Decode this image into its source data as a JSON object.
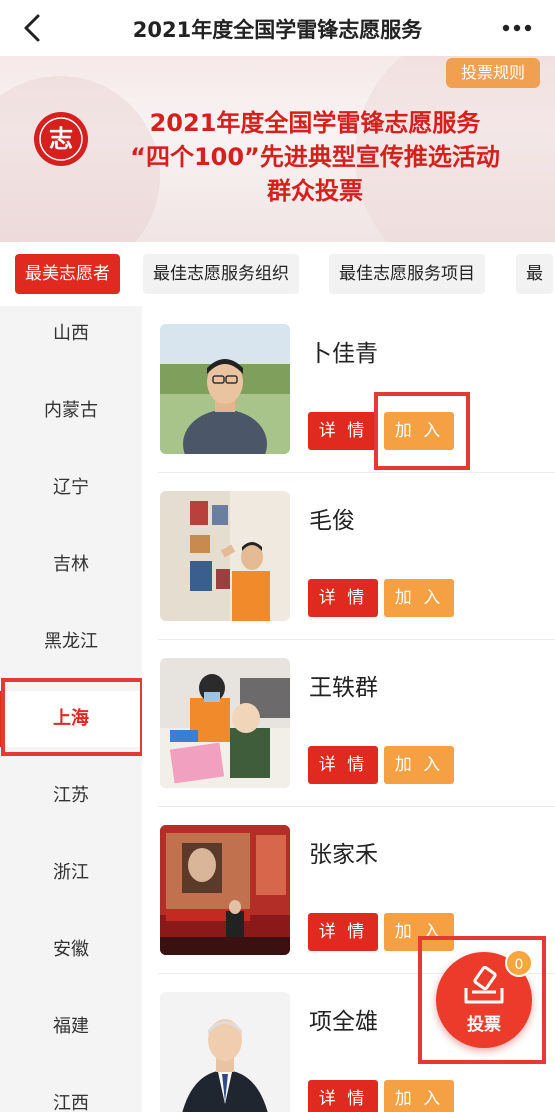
{
  "header": {
    "title": "2021年度全国学雷锋志愿服务",
    "back_icon": "chevron-left-icon",
    "more_icon": "more-icon"
  },
  "banner": {
    "rules_label": "投票规则",
    "line1": "2021年度全国学雷锋志愿服务",
    "line2": "“四个100”先进典型宣传推选活动",
    "line3": "群众投票",
    "logo_char": "志"
  },
  "categories": [
    "最美志愿者",
    "最佳志愿服务组织",
    "最佳志愿服务项目",
    "最"
  ],
  "provinces": [
    "山西",
    "内蒙古",
    "辽宁",
    "吉林",
    "黑龙江",
    "上海",
    "江苏",
    "浙江",
    "安徽",
    "福建",
    "江西"
  ],
  "cards": [
    {
      "name": "卜佳青",
      "detail_label": "详 情",
      "join_label": "加 入"
    },
    {
      "name": "毛俊",
      "detail_label": "详 情",
      "join_label": "加 入"
    },
    {
      "name": "王轶群",
      "detail_label": "详 情",
      "join_label": "加 入"
    },
    {
      "name": "张家禾",
      "detail_label": "详 情",
      "join_label": "加 入"
    },
    {
      "name": "项全雄",
      "detail_label": "详 情",
      "join_label": "加 入"
    }
  ],
  "vote": {
    "label": "投票",
    "count": "0"
  },
  "colors": {
    "accent": "#e12a1f",
    "join": "#f4a043",
    "highlight": "#e53935"
  }
}
